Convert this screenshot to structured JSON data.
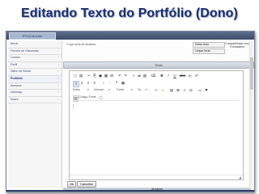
{
  "slide": {
    "title": "Editando Texto do Portfólio (Dono)"
  },
  "app": {
    "logo_text": "IFICA Moodle"
  },
  "sidebar": {
    "items": [
      {
        "label": "Mural"
      },
      {
        "label": "Fórums de Discussão"
      },
      {
        "label": "Correio"
      },
      {
        "label": "Perfil"
      },
      {
        "label": "Diário de Bordo"
      },
      {
        "label": "Portfólio",
        "active": true
      },
      {
        "label": "Acessos"
      },
      {
        "label": "Intermap"
      },
      {
        "label": "Sobre"
      }
    ]
  },
  "main": {
    "hint": "O que acha de atualizar.",
    "shared_link": "Compartilhado com Formadores",
    "edit_text_button": "Editar texto",
    "clear_text_button": "Limpar texto",
    "panel_title": "Texto",
    "editor": {
      "toolbar1": [
        {
          "icon": "new-doc-icon",
          "glyph": "▢"
        },
        {
          "icon": "template-icon",
          "glyph": "▤"
        },
        {
          "icon": "cut-icon",
          "glyph": "✂"
        },
        {
          "icon": "copy-icon",
          "glyph": "⎘"
        },
        {
          "icon": "paste-icon",
          "glyph": "▣"
        },
        {
          "icon": "paste-text-icon",
          "glyph": "▦"
        },
        {
          "icon": "paste-word-icon",
          "glyph": "W"
        },
        {
          "icon": "undo-icon",
          "glyph": "↶"
        },
        {
          "icon": "redo-icon",
          "glyph": "↷"
        },
        {
          "icon": "find-icon",
          "glyph": "⌕"
        },
        {
          "icon": "replace-icon",
          "glyph": "⇄"
        },
        {
          "icon": "select-all-icon",
          "glyph": "▧"
        },
        {
          "icon": "remove-format-icon",
          "glyph": "⌫"
        }
      ],
      "format_buttons": [
        "B",
        "I",
        "U",
        "abc",
        "x₂",
        "x²"
      ],
      "toolbar2_glyphs": [
        "≡",
        "≡",
        "≡",
        "≡",
        "⁝",
        "⋮",
        "❝",
        "▦"
      ],
      "toolbar3": {
        "style_label": "Estilo",
        "format_label": "Normal",
        "font_label": "Fonte",
        "size_label": "Ta..."
      },
      "toolbar3_icons": [
        "A",
        "A",
        "▤",
        "⊞",
        "☺",
        "Ω",
        "▭",
        "⚑"
      ],
      "source_label": "Código-Fonte"
    },
    "ok_button": "Ok",
    "cancel_button": "Cancelar",
    "attachments_label": "Arquivos"
  }
}
